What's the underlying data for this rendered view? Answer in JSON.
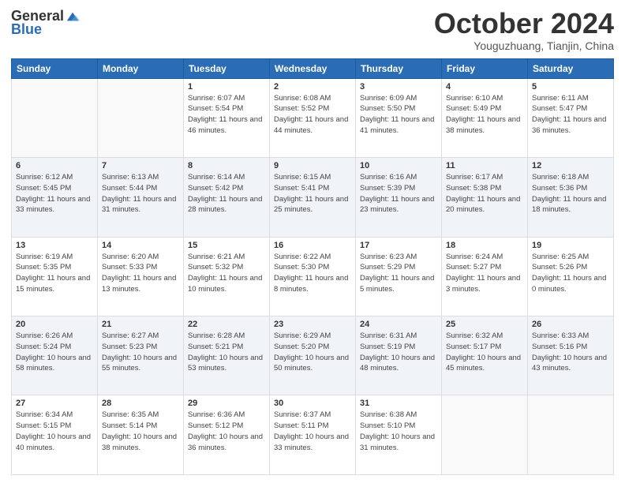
{
  "header": {
    "logo_general": "General",
    "logo_blue": "Blue",
    "month_title": "October 2024",
    "location": "Youguzhuang, Tianjin, China"
  },
  "weekdays": [
    "Sunday",
    "Monday",
    "Tuesday",
    "Wednesday",
    "Thursday",
    "Friday",
    "Saturday"
  ],
  "weeks": [
    [
      {
        "day": "",
        "info": ""
      },
      {
        "day": "",
        "info": ""
      },
      {
        "day": "1",
        "info": "Sunrise: 6:07 AM\nSunset: 5:54 PM\nDaylight: 11 hours and 46 minutes."
      },
      {
        "day": "2",
        "info": "Sunrise: 6:08 AM\nSunset: 5:52 PM\nDaylight: 11 hours and 44 minutes."
      },
      {
        "day": "3",
        "info": "Sunrise: 6:09 AM\nSunset: 5:50 PM\nDaylight: 11 hours and 41 minutes."
      },
      {
        "day": "4",
        "info": "Sunrise: 6:10 AM\nSunset: 5:49 PM\nDaylight: 11 hours and 38 minutes."
      },
      {
        "day": "5",
        "info": "Sunrise: 6:11 AM\nSunset: 5:47 PM\nDaylight: 11 hours and 36 minutes."
      }
    ],
    [
      {
        "day": "6",
        "info": "Sunrise: 6:12 AM\nSunset: 5:45 PM\nDaylight: 11 hours and 33 minutes."
      },
      {
        "day": "7",
        "info": "Sunrise: 6:13 AM\nSunset: 5:44 PM\nDaylight: 11 hours and 31 minutes."
      },
      {
        "day": "8",
        "info": "Sunrise: 6:14 AM\nSunset: 5:42 PM\nDaylight: 11 hours and 28 minutes."
      },
      {
        "day": "9",
        "info": "Sunrise: 6:15 AM\nSunset: 5:41 PM\nDaylight: 11 hours and 25 minutes."
      },
      {
        "day": "10",
        "info": "Sunrise: 6:16 AM\nSunset: 5:39 PM\nDaylight: 11 hours and 23 minutes."
      },
      {
        "day": "11",
        "info": "Sunrise: 6:17 AM\nSunset: 5:38 PM\nDaylight: 11 hours and 20 minutes."
      },
      {
        "day": "12",
        "info": "Sunrise: 6:18 AM\nSunset: 5:36 PM\nDaylight: 11 hours and 18 minutes."
      }
    ],
    [
      {
        "day": "13",
        "info": "Sunrise: 6:19 AM\nSunset: 5:35 PM\nDaylight: 11 hours and 15 minutes."
      },
      {
        "day": "14",
        "info": "Sunrise: 6:20 AM\nSunset: 5:33 PM\nDaylight: 11 hours and 13 minutes."
      },
      {
        "day": "15",
        "info": "Sunrise: 6:21 AM\nSunset: 5:32 PM\nDaylight: 11 hours and 10 minutes."
      },
      {
        "day": "16",
        "info": "Sunrise: 6:22 AM\nSunset: 5:30 PM\nDaylight: 11 hours and 8 minutes."
      },
      {
        "day": "17",
        "info": "Sunrise: 6:23 AM\nSunset: 5:29 PM\nDaylight: 11 hours and 5 minutes."
      },
      {
        "day": "18",
        "info": "Sunrise: 6:24 AM\nSunset: 5:27 PM\nDaylight: 11 hours and 3 minutes."
      },
      {
        "day": "19",
        "info": "Sunrise: 6:25 AM\nSunset: 5:26 PM\nDaylight: 11 hours and 0 minutes."
      }
    ],
    [
      {
        "day": "20",
        "info": "Sunrise: 6:26 AM\nSunset: 5:24 PM\nDaylight: 10 hours and 58 minutes."
      },
      {
        "day": "21",
        "info": "Sunrise: 6:27 AM\nSunset: 5:23 PM\nDaylight: 10 hours and 55 minutes."
      },
      {
        "day": "22",
        "info": "Sunrise: 6:28 AM\nSunset: 5:21 PM\nDaylight: 10 hours and 53 minutes."
      },
      {
        "day": "23",
        "info": "Sunrise: 6:29 AM\nSunset: 5:20 PM\nDaylight: 10 hours and 50 minutes."
      },
      {
        "day": "24",
        "info": "Sunrise: 6:31 AM\nSunset: 5:19 PM\nDaylight: 10 hours and 48 minutes."
      },
      {
        "day": "25",
        "info": "Sunrise: 6:32 AM\nSunset: 5:17 PM\nDaylight: 10 hours and 45 minutes."
      },
      {
        "day": "26",
        "info": "Sunrise: 6:33 AM\nSunset: 5:16 PM\nDaylight: 10 hours and 43 minutes."
      }
    ],
    [
      {
        "day": "27",
        "info": "Sunrise: 6:34 AM\nSunset: 5:15 PM\nDaylight: 10 hours and 40 minutes."
      },
      {
        "day": "28",
        "info": "Sunrise: 6:35 AM\nSunset: 5:14 PM\nDaylight: 10 hours and 38 minutes."
      },
      {
        "day": "29",
        "info": "Sunrise: 6:36 AM\nSunset: 5:12 PM\nDaylight: 10 hours and 36 minutes."
      },
      {
        "day": "30",
        "info": "Sunrise: 6:37 AM\nSunset: 5:11 PM\nDaylight: 10 hours and 33 minutes."
      },
      {
        "day": "31",
        "info": "Sunrise: 6:38 AM\nSunset: 5:10 PM\nDaylight: 10 hours and 31 minutes."
      },
      {
        "day": "",
        "info": ""
      },
      {
        "day": "",
        "info": ""
      }
    ]
  ]
}
